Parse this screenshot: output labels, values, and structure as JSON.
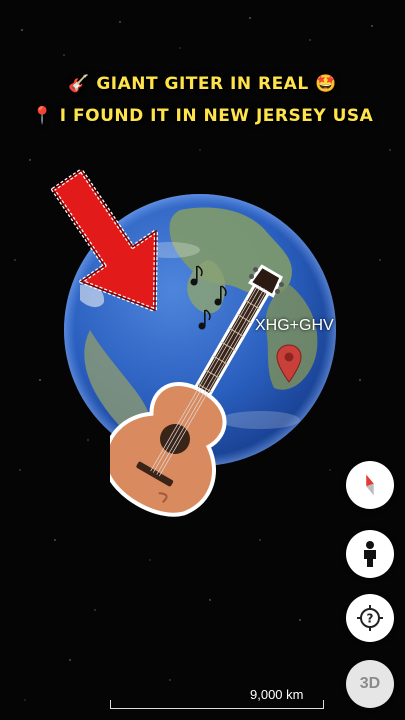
{
  "caption": {
    "line1_emoji": "🎸",
    "line1_text": "GIANT GITER IN REAL",
    "line1_emoji_end": "🤩",
    "line2_emoji": "📍",
    "line2_text": "I FOUND IT IN NEW JERSEY USA"
  },
  "map": {
    "plus_code": "XHG+GHV",
    "scale_label": "9,000 km",
    "three_d_label": "3D"
  },
  "icons": {
    "compass": "compass-icon",
    "person": "street-view-person-icon",
    "locate": "my-location-icon",
    "pin": "map-pin-icon",
    "arrow": "red-arrow-overlay",
    "guitar": "acoustic-guitar-sticker"
  },
  "colors": {
    "caption": "#ffe34a",
    "ocean": "#2f66c4",
    "arrow_red": "#e21a1a",
    "guitar_body": "#d98a5f",
    "pin_red": "#c9403a"
  }
}
